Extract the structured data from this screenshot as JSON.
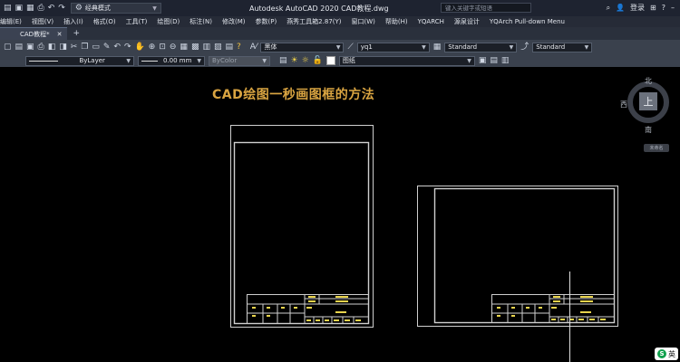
{
  "window": {
    "workspace": "经典模式",
    "app_title": "Autodesk AutoCAD 2020    CAD教程.dwg",
    "search_placeholder": "键入关键字或短语",
    "login_label": "登录"
  },
  "menu": [
    "编辑(E)",
    "视图(V)",
    "插入(I)",
    "格式(O)",
    "工具(T)",
    "绘图(D)",
    "标注(N)",
    "修改(M)",
    "参数(P)",
    "燕秀工具箱2.87(Y)",
    "窗口(W)",
    "帮助(H)",
    "YQARCH",
    "源泉设计",
    "YQArch Pull-down Menu"
  ],
  "document_tab": {
    "label": "CAD教程*"
  },
  "ribbon1": {
    "font_style": "黑体",
    "dim_style": "yq1",
    "table_style": "Standard",
    "multileader_style": "Standard"
  },
  "ribbon2": {
    "linetype": "ByLayer",
    "lineweight": "0.00 mm",
    "plotstyle": "ByColor",
    "layer": "图纸"
  },
  "canvas": {
    "heading": "CAD绘图一秒画图框的方法",
    "title_block_label": "名称代号"
  },
  "viewcube": {
    "top_face": "上",
    "north": "北",
    "south": "南",
    "west": "西",
    "wcs_label": "未命名"
  },
  "ime": {
    "label": "英"
  },
  "colors": {
    "accent": "#d9a441",
    "canvas": "#000000"
  }
}
